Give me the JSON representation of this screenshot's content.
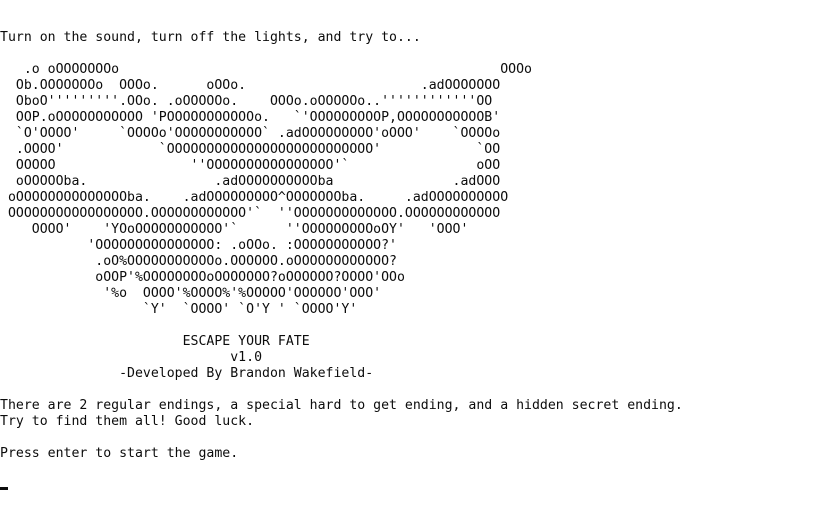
{
  "console": {
    "intro": "Turn on the sound, turn off the lights, and try to...",
    "blank": "",
    "art": [
      "   .o oOOOOOOOo                                                OOOo",
      "  Ob.OOOOOOOo  OOOo.      oOOo.                      .adOOOOOOO",
      "  OboO'''''''''.OOo. .oOOOOOo.    OOOo.oOOOOOo..''''''''''''OO",
      "  OOP.oOOOOOOOOOOO 'POOOOOOOOOOOo.   `'OOOOOOOOOP,OOOOOOOOOOOB'",
      "  `O'OOOO'     `OOOOo'OOOOOOOOOOO` .adOOOOOOOOO'oOOO'    `OOOOo",
      "  .OOOO'            `OOOOOOOOOOOOOOOOOOOOOOOOOO'            `OO",
      "  OOOOO                 ''OOOOOOOOOOOOOOOO'`                oOO",
      "  oOOOOOba.                .adOOOOOOOOOOba               .adOOO",
      " oOOOOOOOOOOOOOOba.    .adOOOOOOOOO^OOOOOOOba.     .adOOOOOOOOOO",
      " OOOOOOOOOOOOOOOOO.OOOOOOOOOOOO'`  ''OOOOOOOOOOOOO.OOOOOOOOOOOO",
      "    OOOO'    'YOoOOOOOOOOOOO'`      ''OOOOOOOOOoOY'   'OOO'",
      "           'OOOOOOOOOOOOOOO: .oOOo. :OOOOOOOOOOO?'",
      "            .oO%OOOOOOOOOOOo.OOOOOO.oOOOOOOOOOOOO?",
      "            oOOP'%OOOOOOOOoOOOOOOO?oOOOOOO?OOOO'OOo",
      "             '%o  OOOO'%OOOO%'%OOOOO'OOOOOO'OOO'",
      "                  `Y'  `OOOO' `O'Y ' `OOOO'Y'"
    ],
    "title": "                       ESCAPE YOUR FATE",
    "version": "                             v1.0",
    "credit": "               -Developed By Brandon Wakefield-",
    "endings_line": "There are 2 regular endings, a special hard to get ending, and a hidden secret ending.",
    "goodluck_line": "Try to find them all! Good luck.",
    "prompt": "Press enter to start the game."
  }
}
